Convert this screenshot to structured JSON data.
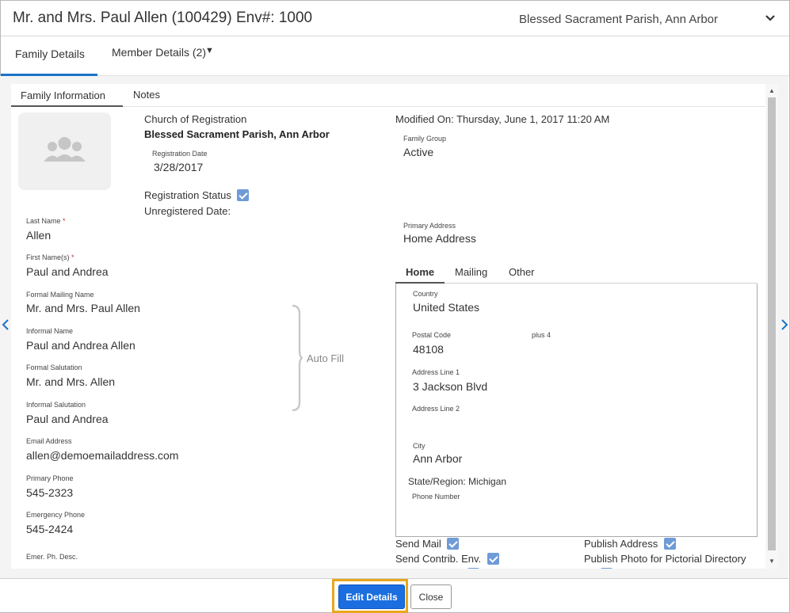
{
  "header": {
    "title": "Mr. and Mrs. Paul Allen (100429) Env#: 1000",
    "parish": "Blessed Sacrament Parish, Ann Arbor",
    "expand_icon": "chevron-down-icon"
  },
  "top_tabs": {
    "family_details": "Family Details",
    "member_details": "Member Details (2)",
    "member_details_icon": "triangle-down-icon"
  },
  "inner_tabs": {
    "family_information": "Family Information",
    "notes": "Notes"
  },
  "left": {
    "church_label": "Church of Registration",
    "church_value": "Blessed Sacrament Parish, Ann Arbor",
    "reg_date_label": "Registration Date",
    "reg_date_value": "3/28/2017",
    "reg_status_label": "Registration Status",
    "unregistered_label": "Unregistered Date:",
    "last_name_label": "Last Name",
    "last_name_value": "Allen",
    "first_name_label": "First Name(s)",
    "first_name_value": "Paul and Andrea",
    "formal_mailing_label": "Formal Mailing Name",
    "formal_mailing_value": "Mr. and Mrs. Paul Allen",
    "informal_name_label": "Informal Name",
    "informal_name_value": "Paul and Andrea Allen",
    "formal_salutation_label": "Formal Salutation",
    "formal_salutation_value": "Mr. and Mrs. Allen",
    "informal_salutation_label": "Informal Salutation",
    "informal_salutation_value": "Paul and Andrea",
    "auto_fill": "Auto Fill",
    "email_label": "Email Address",
    "email_value": "allen@demoemailaddress.com",
    "primary_phone_label": "Primary Phone",
    "primary_phone_value": "545-2323",
    "emergency_phone_label": "Emergency Phone",
    "emergency_phone_value": "545-2424",
    "emer_desc_label": "Emer. Ph. Desc.",
    "required_mark": "*"
  },
  "right": {
    "modified_on": "Modified On: Thursday, June 1, 2017 11:20 AM",
    "family_group_label": "Family Group",
    "family_group_value": "Active",
    "primary_address_label": "Primary Address",
    "primary_address_value": "Home Address"
  },
  "address_tabs": {
    "home": "Home",
    "mailing": "Mailing",
    "other": "Other"
  },
  "address": {
    "country_label": "Country",
    "country_value": "United States",
    "postal_label": "Postal Code",
    "postal_value": "48108",
    "plus4_label": "plus 4",
    "line1_label": "Address Line 1",
    "line1_value": "3 Jackson Blvd",
    "line2_label": "Address Line 2",
    "city_label": "City",
    "city_value": "Ann Arbor",
    "state": "State/Region: Michigan",
    "phone_label": "Phone Number"
  },
  "options": {
    "send_mail": "Send Mail",
    "send_contrib": "Send Contrib. Env.",
    "publish_address": "Publish Address",
    "publish_photo": "Publish Photo for Pictorial Directory"
  },
  "footer": {
    "edit_label": "Edit Details",
    "close_label": "Close"
  },
  "colors": {
    "accent": "#1b6ee0",
    "checkbox": "#6f9bd8",
    "focus": "#e8a71c",
    "required": "#c23934"
  }
}
